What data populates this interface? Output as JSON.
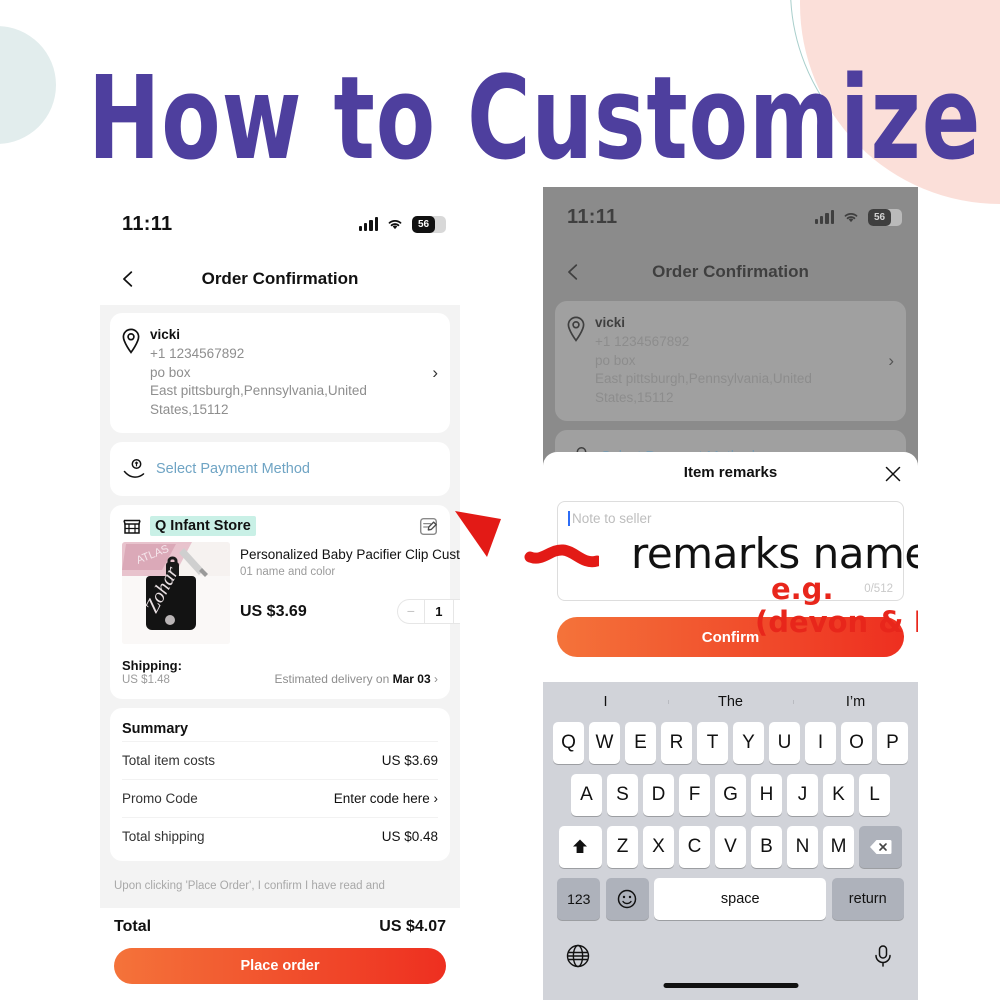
{
  "headline": "How to Customize",
  "theme": {
    "accent_purple": "#4e3f9e",
    "deco_pink": "#fbdfd9",
    "deco_mint": "#e2eded",
    "cta_gradient_from": "#f4733a",
    "cta_gradient_to": "#ee2f20",
    "annotation_red": "#e8261b",
    "store_highlight": "#c9f0e6",
    "link_blue": "#6fa4c4"
  },
  "left_phone": {
    "status_bar": {
      "time": "11:11",
      "battery_level": "56",
      "signal": "signal-bars-icon",
      "wifi": "wifi-icon"
    },
    "nav": {
      "back": "back-arrow-icon",
      "title": "Order Confirmation"
    },
    "address": {
      "icon": "location-pin-icon",
      "name": "vicki",
      "phone": "+1 1234567892",
      "line1": "po box",
      "line2": "East pittsburgh,Pennsylvania,United",
      "line3": "States,15112",
      "chevron": "›"
    },
    "payment": {
      "icon": "payment-hand-icon",
      "label": "Select Payment Method"
    },
    "store": {
      "icon": "storefront-icon",
      "name": "Q Infant Store",
      "edit_icon": "edit-note-icon"
    },
    "product": {
      "title": "Personalized Baby Pacifier Clip Custo…",
      "variant": "01 name and color",
      "price": "US $3.69",
      "quantity": "1",
      "minus": "−",
      "plus": "+"
    },
    "shipping": {
      "label": "Shipping:",
      "cost": "US $1.48",
      "delivery": "Estimated delivery on",
      "delivery_date": "Mar 03",
      "chevron": "›"
    },
    "summary": {
      "title": "Summary",
      "rows": [
        {
          "label": "Total item costs",
          "value": "US $3.69"
        },
        {
          "label": "Promo Code",
          "value": "Enter code here ›"
        },
        {
          "label": "Total shipping",
          "value": "US $0.48"
        }
      ]
    },
    "disclaimer": "Upon clicking 'Place Order', I confirm I have read and",
    "footer": {
      "total_label": "Total",
      "total_value": "US $4.07",
      "cta": "Place order"
    }
  },
  "right_phone": {
    "status_bar": {
      "time": "11:11",
      "battery_level": "56"
    },
    "nav": {
      "back": "back-arrow-icon",
      "title": "Order Confirmation"
    },
    "address": {
      "name": "vicki",
      "phone": "+1 1234567892",
      "line1": "po box",
      "line2": "East pittsburgh,Pennsylvania,United",
      "line3": "States,15112",
      "chevron": "›"
    },
    "payment_label": "Select Payment Method",
    "modal": {
      "title": "Item remarks",
      "close": "close-icon",
      "placeholder": "Note to seller",
      "counter": "0/512",
      "confirm": "Confirm"
    },
    "annotations": {
      "remarks_name": "remarks name",
      "eg": "e.g.",
      "example": "(devon & BU)"
    },
    "keyboard": {
      "predictions": [
        "I",
        "The",
        "I’m"
      ],
      "row1": [
        "Q",
        "W",
        "E",
        "R",
        "T",
        "Y",
        "U",
        "I",
        "O",
        "P"
      ],
      "row2": [
        "A",
        "S",
        "D",
        "F",
        "G",
        "H",
        "J",
        "K",
        "L"
      ],
      "row3": [
        "Z",
        "X",
        "C",
        "V",
        "B",
        "N",
        "M"
      ],
      "shift": "shift-icon",
      "backspace": "backspace-icon",
      "numbers": "123",
      "emoji": "emoji-icon",
      "space": "space",
      "return": "return",
      "globe": "globe-icon",
      "mic": "microphone-icon"
    }
  }
}
